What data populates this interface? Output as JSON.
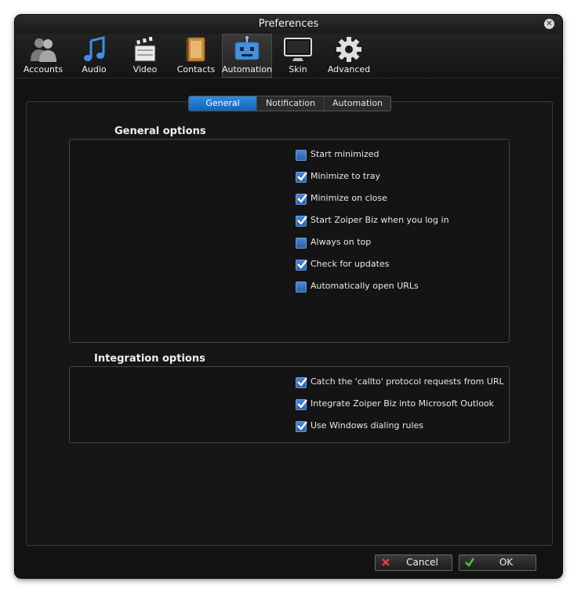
{
  "window": {
    "title": "Preferences"
  },
  "toolbar": {
    "items": [
      {
        "label": "Accounts",
        "icon": "accounts-icon"
      },
      {
        "label": "Audio",
        "icon": "audio-icon"
      },
      {
        "label": "Video",
        "icon": "video-icon"
      },
      {
        "label": "Contacts",
        "icon": "contacts-icon"
      },
      {
        "label": "Automation",
        "icon": "automation-icon",
        "active": true
      },
      {
        "label": "Skin",
        "icon": "skin-icon"
      },
      {
        "label": "Advanced",
        "icon": "advanced-icon"
      }
    ]
  },
  "tabs": [
    {
      "label": "General",
      "active": true
    },
    {
      "label": "Notification"
    },
    {
      "label": "Automation"
    }
  ],
  "general": {
    "title": "General options",
    "options": [
      {
        "label": "Start minimized",
        "checked": false
      },
      {
        "label": "Minimize to tray",
        "checked": true
      },
      {
        "label": "Minimize on close",
        "checked": true
      },
      {
        "label": "Start Zoiper Biz when you log in",
        "checked": true
      },
      {
        "label": "Always on top",
        "checked": false
      },
      {
        "label": "Check for updates",
        "checked": true
      },
      {
        "label": "Automatically open URLs",
        "checked": false
      }
    ]
  },
  "integration": {
    "title": "Integration options",
    "options": [
      {
        "label": "Catch the 'callto' protocol requests from URL",
        "checked": true
      },
      {
        "label": "Integrate Zoiper Biz into Microsoft Outlook",
        "checked": true
      },
      {
        "label": "Use Windows dialing rules",
        "checked": true
      }
    ]
  },
  "buttons": {
    "cancel": "Cancel",
    "ok": "OK"
  },
  "colors": {
    "accent": "#1565b8",
    "checkbox": "#3b72c4",
    "background": "#121212"
  }
}
